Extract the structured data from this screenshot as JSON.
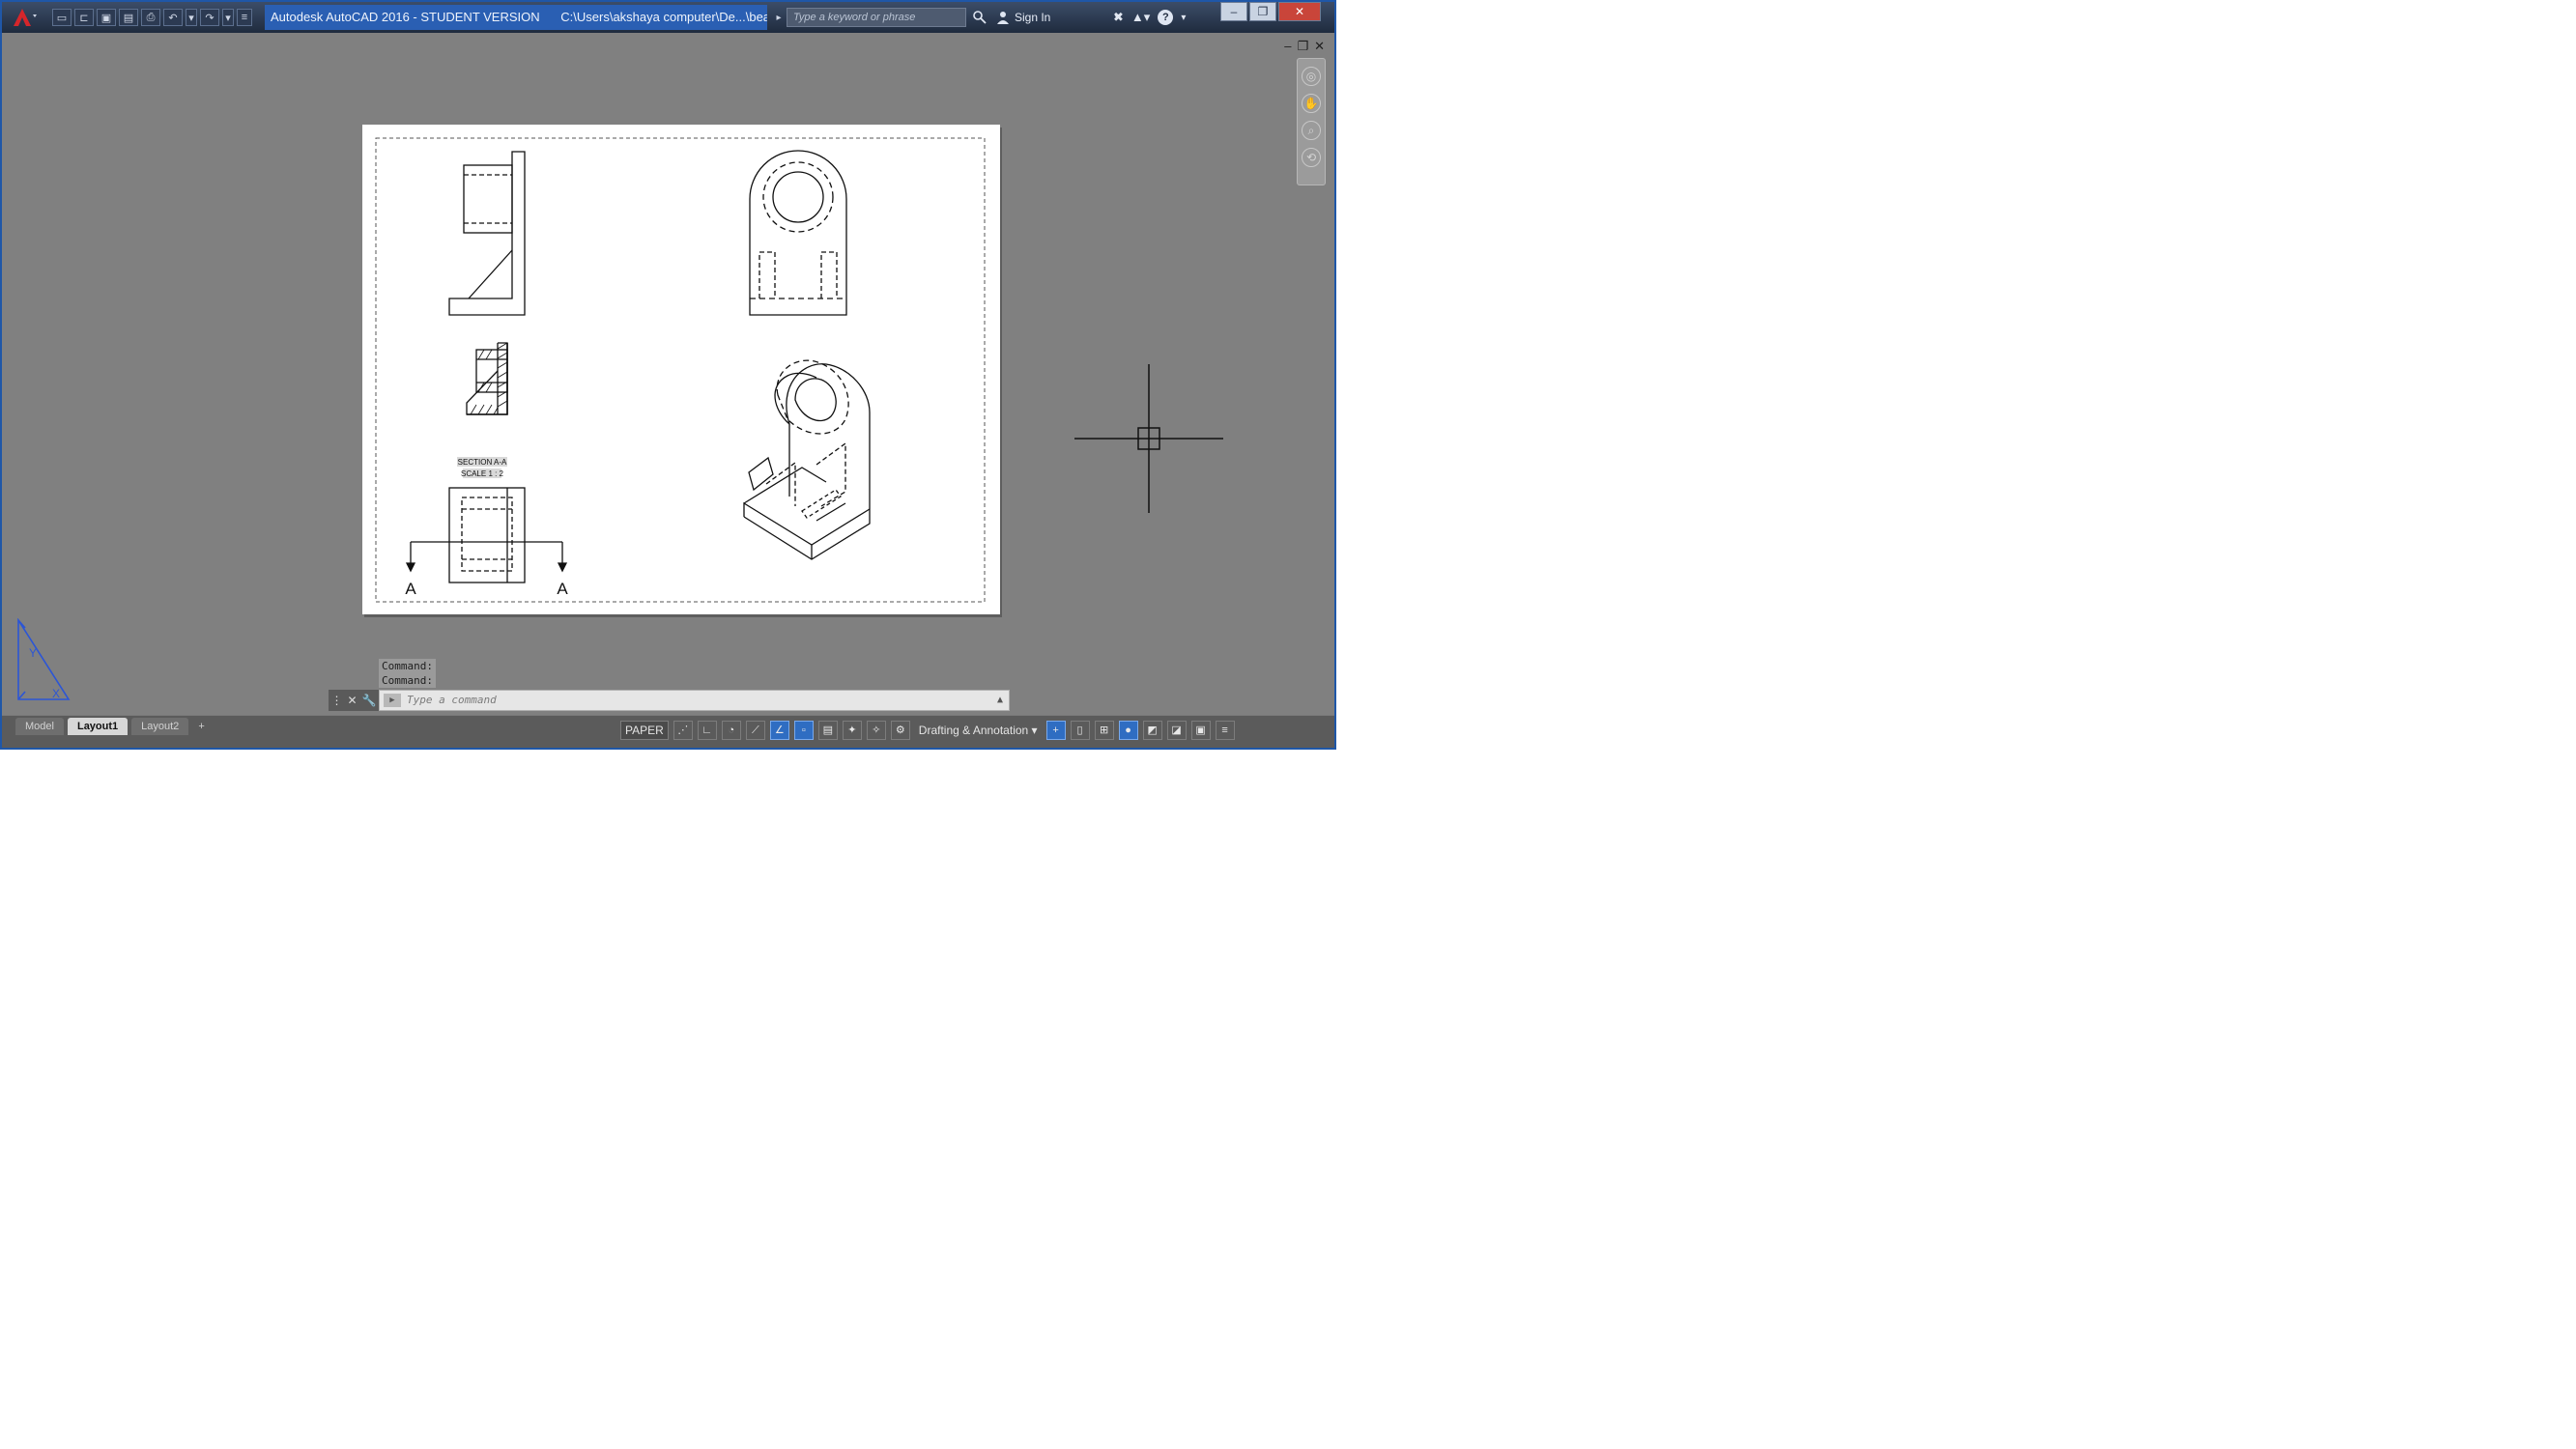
{
  "app": {
    "name": "Autodesk AutoCAD 2016 - STUDENT VERSION",
    "file_path": "C:\\Users\\akshaya computer\\De...\\bearing.dwg"
  },
  "search": {
    "placeholder": "Type a keyword or phrase"
  },
  "account": {
    "sign_in": "Sign In"
  },
  "window": {
    "minimize": "–",
    "restore": "❐",
    "close": "✕"
  },
  "drawing": {
    "section_label": "SECTION A-A",
    "scale_label": "SCALE 1 : 2",
    "cut_marker_left": "A",
    "cut_marker_right": "A"
  },
  "command_line": {
    "history": [
      "Command:",
      "Command:"
    ],
    "placeholder": "Type a command",
    "prompt_icon": "▶"
  },
  "layout_tabs": {
    "items": [
      {
        "label": "Model",
        "active": false
      },
      {
        "label": "Layout1",
        "active": true
      },
      {
        "label": "Layout2",
        "active": false
      }
    ],
    "add": "+"
  },
  "status": {
    "space": "PAPER",
    "workspace": "Drafting & Annotation"
  },
  "colors": {
    "title_bar": "#1f2b3e",
    "title_highlight": "#2a5fb3",
    "canvas": "#808080",
    "paper": "#ffffff",
    "ucs": "#2b55d6",
    "status_active": "#2f6dc2"
  }
}
